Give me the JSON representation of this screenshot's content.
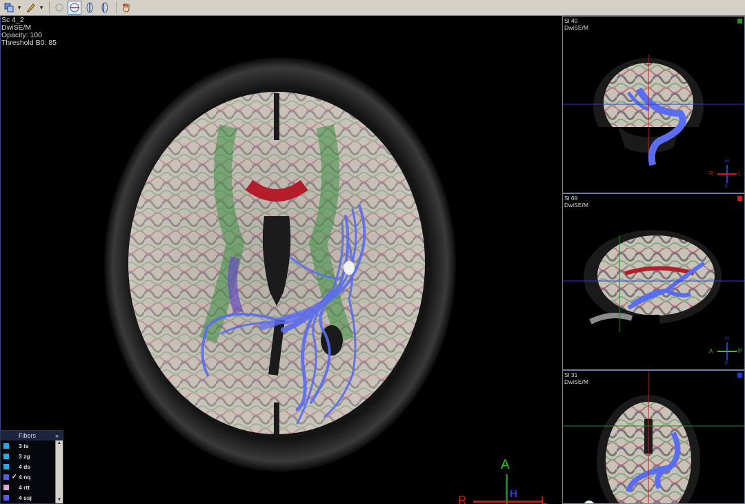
{
  "toolbar": {
    "buttons": [
      {
        "icon": "layers-icon",
        "dropdown": true
      },
      {
        "icon": "pen-icon",
        "dropdown": true
      },
      {
        "icon": "rotate-icon",
        "disabled": true
      },
      {
        "icon": "axial-plane-icon",
        "active": true
      },
      {
        "icon": "coronal-plane-icon"
      },
      {
        "icon": "sagittal-plane-icon"
      },
      {
        "icon": "hand-tool-icon"
      }
    ]
  },
  "main_view": {
    "overlay": [
      "Sc 4_2",
      "DwiSE/M",
      "Opacity: 100",
      "Threshold B0: 85"
    ],
    "orientation": {
      "top": "A",
      "left": "R",
      "right": "L",
      "center": "H"
    }
  },
  "panels": [
    {
      "slice": "Sl 40",
      "series": "DwiSE/M",
      "marker_color": "#1a9a1a",
      "orientation": {
        "left": "R",
        "right": "L",
        "top": "H",
        "bottom": "F"
      }
    },
    {
      "slice": "Sl 69",
      "series": "DwiSE/M",
      "marker_color": "#e01a1a",
      "orientation": {
        "left": "A",
        "right": "P",
        "top": "H",
        "bottom": "F"
      }
    },
    {
      "slice": "Sl 31",
      "series": "DwiSE/M",
      "marker_color": "#1a3ae0",
      "orientation": {}
    }
  ],
  "fibers": {
    "title": "Fibers",
    "expand_glyph": "»",
    "items": [
      {
        "label": "3 ts",
        "color": "#27a9e1",
        "checked": false
      },
      {
        "label": "3 zg",
        "color": "#27a9e1",
        "checked": false
      },
      {
        "label": "4 ds",
        "color": "#27a9e1",
        "checked": false
      },
      {
        "label": "4 nq",
        "color": "#5a5ae8",
        "checked": true
      },
      {
        "label": "4 rtt",
        "color": "#e6a0d8",
        "checked": false
      },
      {
        "label": "4 ssj",
        "color": "#5a5ae8",
        "checked": false
      }
    ]
  },
  "colors": {
    "fiber": "#5a6cf0",
    "crosshair_blue": "#2b3bd8",
    "crosshair_red": "#c81818",
    "crosshair_green": "#1a8a1a"
  }
}
